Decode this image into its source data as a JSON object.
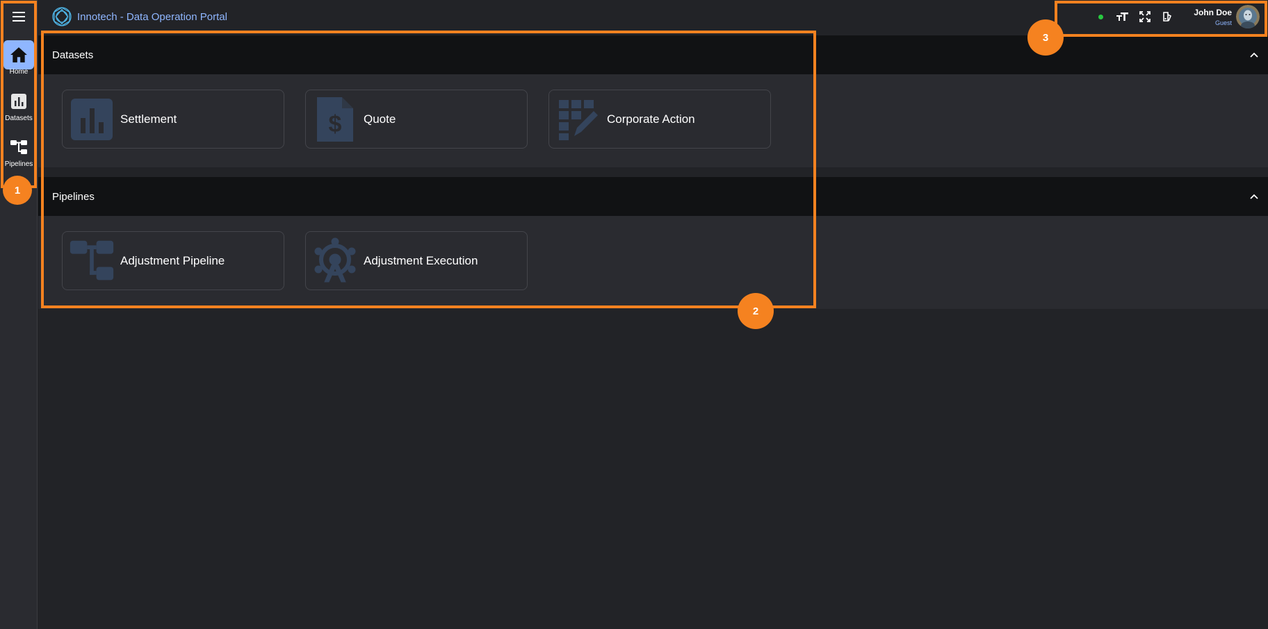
{
  "app": {
    "title": "Innotech - Data Operation Portal"
  },
  "sidebar": {
    "items": [
      {
        "label": "Home",
        "icon": "home-icon"
      },
      {
        "label": "Datasets",
        "icon": "bar-chart-icon"
      },
      {
        "label": "Pipelines",
        "icon": "pipeline-icon"
      }
    ]
  },
  "header": {
    "status": "online",
    "user_name": "John Doe",
    "user_role": "Guest"
  },
  "sections": [
    {
      "title": "Datasets",
      "cards": [
        {
          "label": "Settlement",
          "icon": "bar-chart-icon"
        },
        {
          "label": "Quote",
          "icon": "invoice-dollar-icon"
        },
        {
          "label": "Corporate Action",
          "icon": "grid-edit-icon"
        }
      ]
    },
    {
      "title": "Pipelines",
      "cards": [
        {
          "label": "Adjustment Pipeline",
          "icon": "pipeline-icon"
        },
        {
          "label": "Adjustment Execution",
          "icon": "network-hub-icon"
        }
      ]
    }
  ],
  "annotations": [
    "1",
    "2",
    "3"
  ],
  "colors": {
    "accent": "#8fb6ff",
    "annotation": "#f58220",
    "status": "#28c840",
    "card_icon": "#3a4a63"
  }
}
